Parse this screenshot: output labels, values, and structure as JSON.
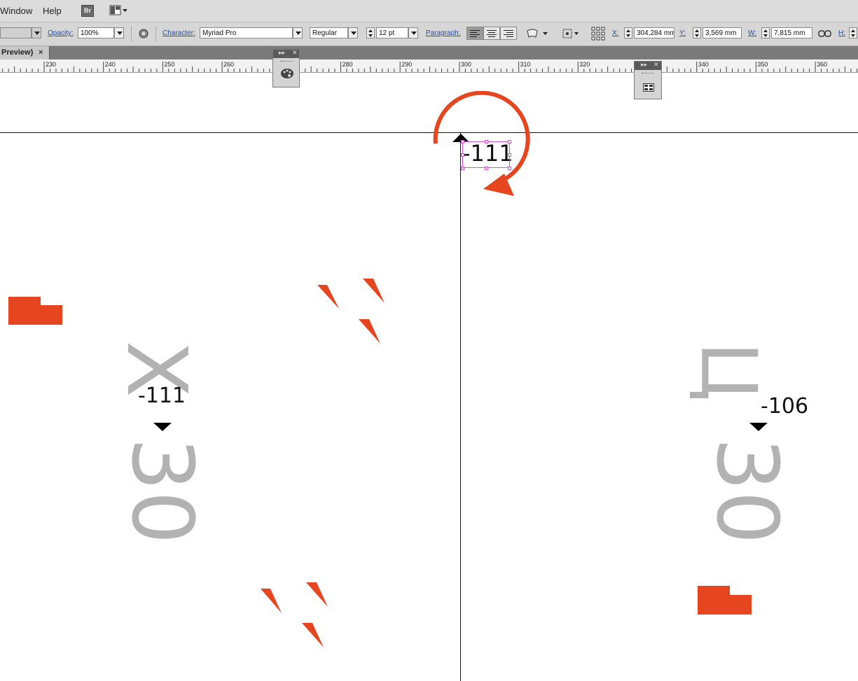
{
  "menubar": {
    "items": [
      "Window",
      "Help"
    ],
    "bridge_label": "Br"
  },
  "control": {
    "opacity_label": "Opacity:",
    "opacity_value": "100%",
    "character_label": "Character:",
    "font_family": "Myriad Pro",
    "font_style": "Regular",
    "font_size": "12 pt",
    "paragraph_label": "Paragraph:",
    "x_label": "X:",
    "x_value": "304,284 mm",
    "y_label": "Y:",
    "y_value": "3,569 mm",
    "w_label": "W:",
    "w_value": "7,815 mm",
    "h_label": "H:"
  },
  "tab": {
    "title": "Preview)",
    "close": "×"
  },
  "ruler": {
    "ticks": [
      "230",
      "240",
      "250",
      "260",
      "280",
      "290",
      "300",
      "310",
      "320",
      "340",
      "350",
      "360"
    ]
  },
  "canvas": {
    "kern_selected": "-111",
    "kern_left": "-111",
    "kern_right": "-106",
    "glyph_x": "X",
    "glyph_tse": "Ц",
    "num_left": "30",
    "num_right": "30"
  },
  "colors": {
    "accent": "#e5461f",
    "selection": "#d055d0",
    "glyph_gray": "#b2b2b2"
  },
  "icons": [
    "palette-icon",
    "panel-icon",
    "rotate-arrow-icon"
  ]
}
